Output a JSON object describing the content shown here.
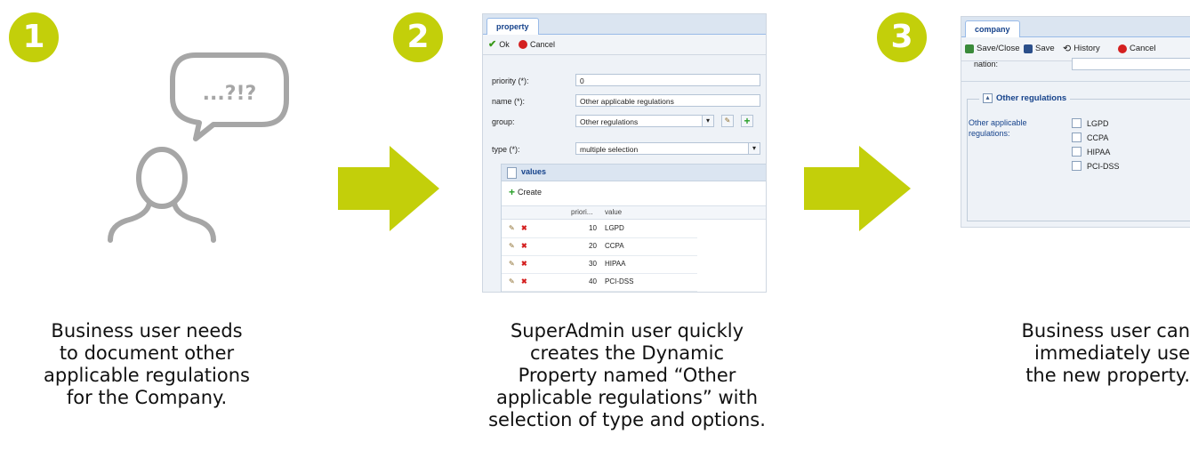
{
  "steps": [
    {
      "number": "1",
      "caption": [
        "Business user needs",
        "to document other",
        "applicable regulations",
        "for the Company."
      ]
    },
    {
      "number": "2",
      "caption": [
        "SuperAdmin user quickly",
        "creates the Dynamic",
        "Property named “Other",
        "applicable regulations” with",
        "selection of type and options."
      ]
    },
    {
      "number": "3",
      "caption": [
        "Business user can",
        "immediately use",
        "the new property."
      ]
    }
  ],
  "speech_bubble": "...?!?",
  "property_form": {
    "tab": "property",
    "ok_label": "Ok",
    "cancel_label": "Cancel",
    "fields": [
      {
        "label": "priority (*):",
        "value": "0"
      },
      {
        "label": "name (*):",
        "value": "Other applicable regulations"
      },
      {
        "label": "group:",
        "value": "Other regulations"
      },
      {
        "label": "type (*):",
        "value": "multiple selection"
      }
    ],
    "values_panel": {
      "title": "values",
      "create_label": "Create",
      "columns": [
        "priori...",
        "value"
      ],
      "rows": [
        {
          "priority": "10",
          "value": "LGPD"
        },
        {
          "priority": "20",
          "value": "CCPA"
        },
        {
          "priority": "30",
          "value": "HIPAA"
        },
        {
          "priority": "40",
          "value": "PCI-DSS"
        }
      ]
    }
  },
  "company_form": {
    "tab": "company",
    "toolbar": [
      "Save/Close",
      "Save",
      "History",
      "Cancel"
    ],
    "cut_label": "nation:",
    "section_title": "Other regulations",
    "field_label": [
      "Other applicable",
      "regulations:"
    ],
    "options": [
      "LGPD",
      "CCPA",
      "HIPAA",
      "PCI-DSS"
    ]
  },
  "colors": {
    "accent": "#c3cf0a",
    "icon_gray": "#a6a6a6"
  }
}
